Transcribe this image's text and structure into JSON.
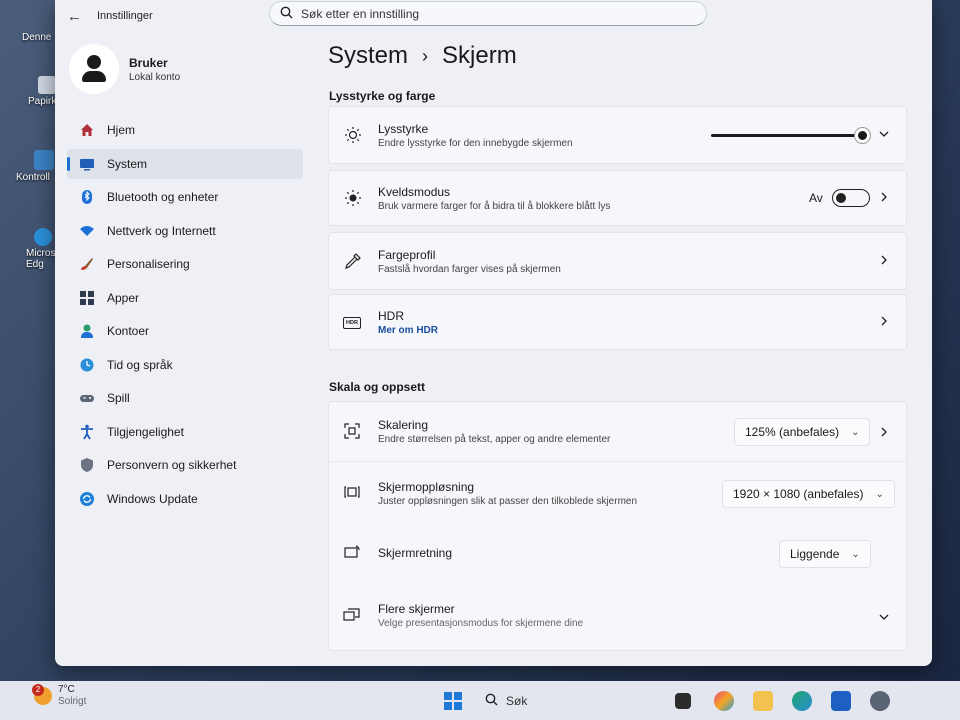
{
  "desktop": {
    "icons": [
      {
        "label": "Denne"
      },
      {
        "label": "Papirk"
      },
      {
        "label": "Kontroll"
      },
      {
        "label": "Micros Edg"
      }
    ]
  },
  "window": {
    "title": "Innstillinger",
    "search_placeholder": "Søk etter en innstilling"
  },
  "profile": {
    "name": "Bruker",
    "account_type": "Lokal konto"
  },
  "sidebar": {
    "items": [
      {
        "label": "Hjem",
        "icon": "home-icon"
      },
      {
        "label": "System",
        "icon": "system-icon",
        "active": true
      },
      {
        "label": "Bluetooth og enheter",
        "icon": "bluetooth-icon"
      },
      {
        "label": "Nettverk og Internett",
        "icon": "wifi-icon"
      },
      {
        "label": "Personalisering",
        "icon": "brush-icon"
      },
      {
        "label": "Apper",
        "icon": "apps-icon"
      },
      {
        "label": "Kontoer",
        "icon": "account-icon"
      },
      {
        "label": "Tid og språk",
        "icon": "globe-clock-icon"
      },
      {
        "label": "Spill",
        "icon": "gamepad-icon"
      },
      {
        "label": "Tilgjengelighet",
        "icon": "accessibility-icon"
      },
      {
        "label": "Personvern og sikkerhet",
        "icon": "shield-icon"
      },
      {
        "label": "Windows Update",
        "icon": "update-icon"
      }
    ]
  },
  "main": {
    "breadcrumb_parent": "System",
    "breadcrumb_sep": "›",
    "breadcrumb_current": "Skjerm",
    "section1_title": "Lysstyrke og farge",
    "brightness": {
      "title": "Lysstyrke",
      "subtitle": "Endre lysstyrke for den innebygde skjermen",
      "level": 1.0
    },
    "night_mode": {
      "title": "Kveldsmodus",
      "subtitle": "Bruk varmere farger for å bidra til å blokkere blått lys",
      "state_label": "Av"
    },
    "color_profile": {
      "title": "Fargeprofil",
      "subtitle": "Fastslå hvordan farger vises på skjermen"
    },
    "hdr": {
      "title": "HDR",
      "subtitle": "Mer om HDR",
      "icon_text": "HDR"
    },
    "section2_title": "Skala og oppsett",
    "scaling": {
      "title": "Skalering",
      "subtitle": "Endre størrelsen på tekst, apper og andre elementer",
      "value": "125% (anbefales)"
    },
    "resolution": {
      "title": "Skjermoppløsning",
      "subtitle": "Juster oppløsningen slik at passer den tilkoblede skjermen",
      "value": "1920 × 1080 (anbefales)"
    },
    "orientation": {
      "title": "Skjermretning",
      "value": "Liggende"
    },
    "multiple": {
      "title": "Flere skjermer",
      "subtitle": "Velge presentasjonsmodus for skjermene dine"
    }
  },
  "taskbar": {
    "weather_temp": "7°C",
    "weather_cond": "Solrigt",
    "weather_badge": "2",
    "search_label": "Søk"
  },
  "colors": {
    "accent": "#1f6fd1",
    "window_bg": "#eef0f6",
    "card_bg": "#f6f7fa"
  }
}
